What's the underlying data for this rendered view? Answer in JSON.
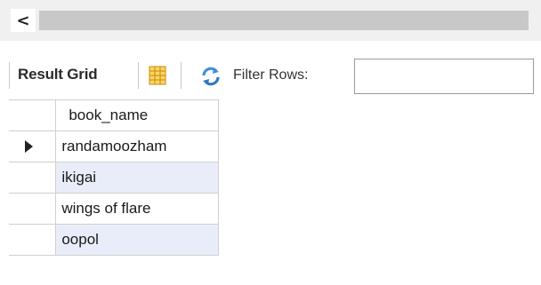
{
  "scrollbar": {
    "left_arrow": "<"
  },
  "toolbar": {
    "result_grid_label": "Result Grid",
    "grid_icon": "grid-layout-icon",
    "refresh_icon": "refresh-icon",
    "filter_label": "Filter Rows:",
    "filter_value": ""
  },
  "grid": {
    "columns": [
      "book_name"
    ],
    "rows": [
      {
        "book_name": "randamoozham",
        "current": true
      },
      {
        "book_name": "ikigai",
        "current": false
      },
      {
        "book_name": "wings of flare",
        "current": false
      },
      {
        "book_name": "oopol",
        "current": false
      }
    ]
  },
  "colors": {
    "alt_row": "#e8edf9",
    "grid_icon": "#f0b020",
    "refresh_icon": "#3f8fd8"
  }
}
